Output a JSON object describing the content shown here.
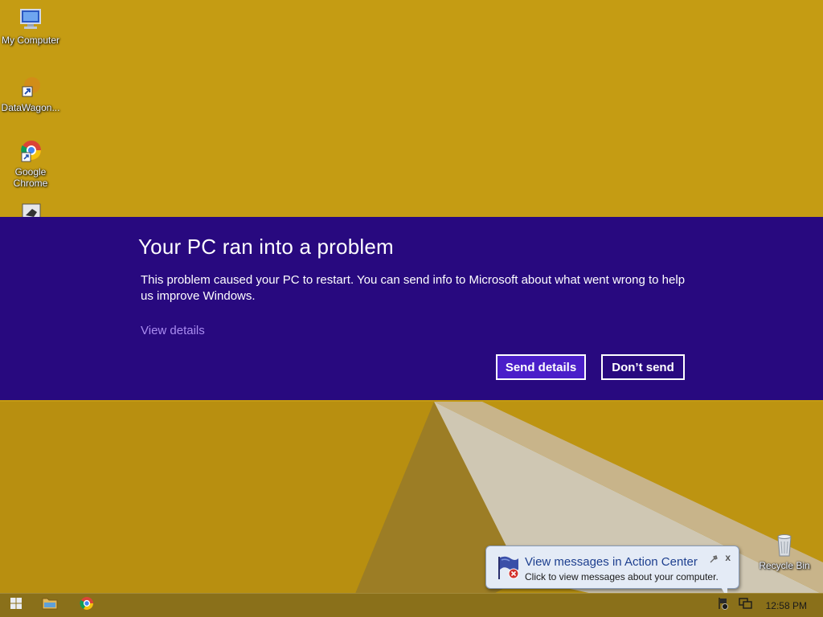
{
  "desktop": {
    "icons": [
      {
        "label": "My Computer",
        "icon": "computer-icon"
      },
      {
        "label": "DataWagon...",
        "icon": "shortcut-icon"
      },
      {
        "label": "Google Chrome",
        "icon": "chrome-icon"
      },
      {
        "label": "",
        "icon": "app-shortcut-icon"
      }
    ],
    "recycle_bin": {
      "label": "Recycle Bin",
      "icon": "recycle-bin-icon"
    }
  },
  "dialog": {
    "title": "Your PC ran into a problem",
    "message": "This problem caused your PC to restart. You can send info to Microsoft about what went wrong to help us improve Windows.",
    "view_details": "View details",
    "send_label": "Send details",
    "dont_send_label": "Don’t send",
    "colors": {
      "background": "#28097f",
      "accent_button": "#4a1ec9",
      "link": "#a98cf0"
    }
  },
  "notification": {
    "title": "View messages in Action Center",
    "text": "Click to view messages about your computer.",
    "close": "x",
    "icon": "action-center-flag-icon"
  },
  "taskbar": {
    "start_icon": "windows-start-icon",
    "pinned": [
      "file-explorer-icon",
      "chrome-icon"
    ],
    "tray": [
      "action-center-icon",
      "network-icon"
    ],
    "clock": "12:58 PM"
  }
}
